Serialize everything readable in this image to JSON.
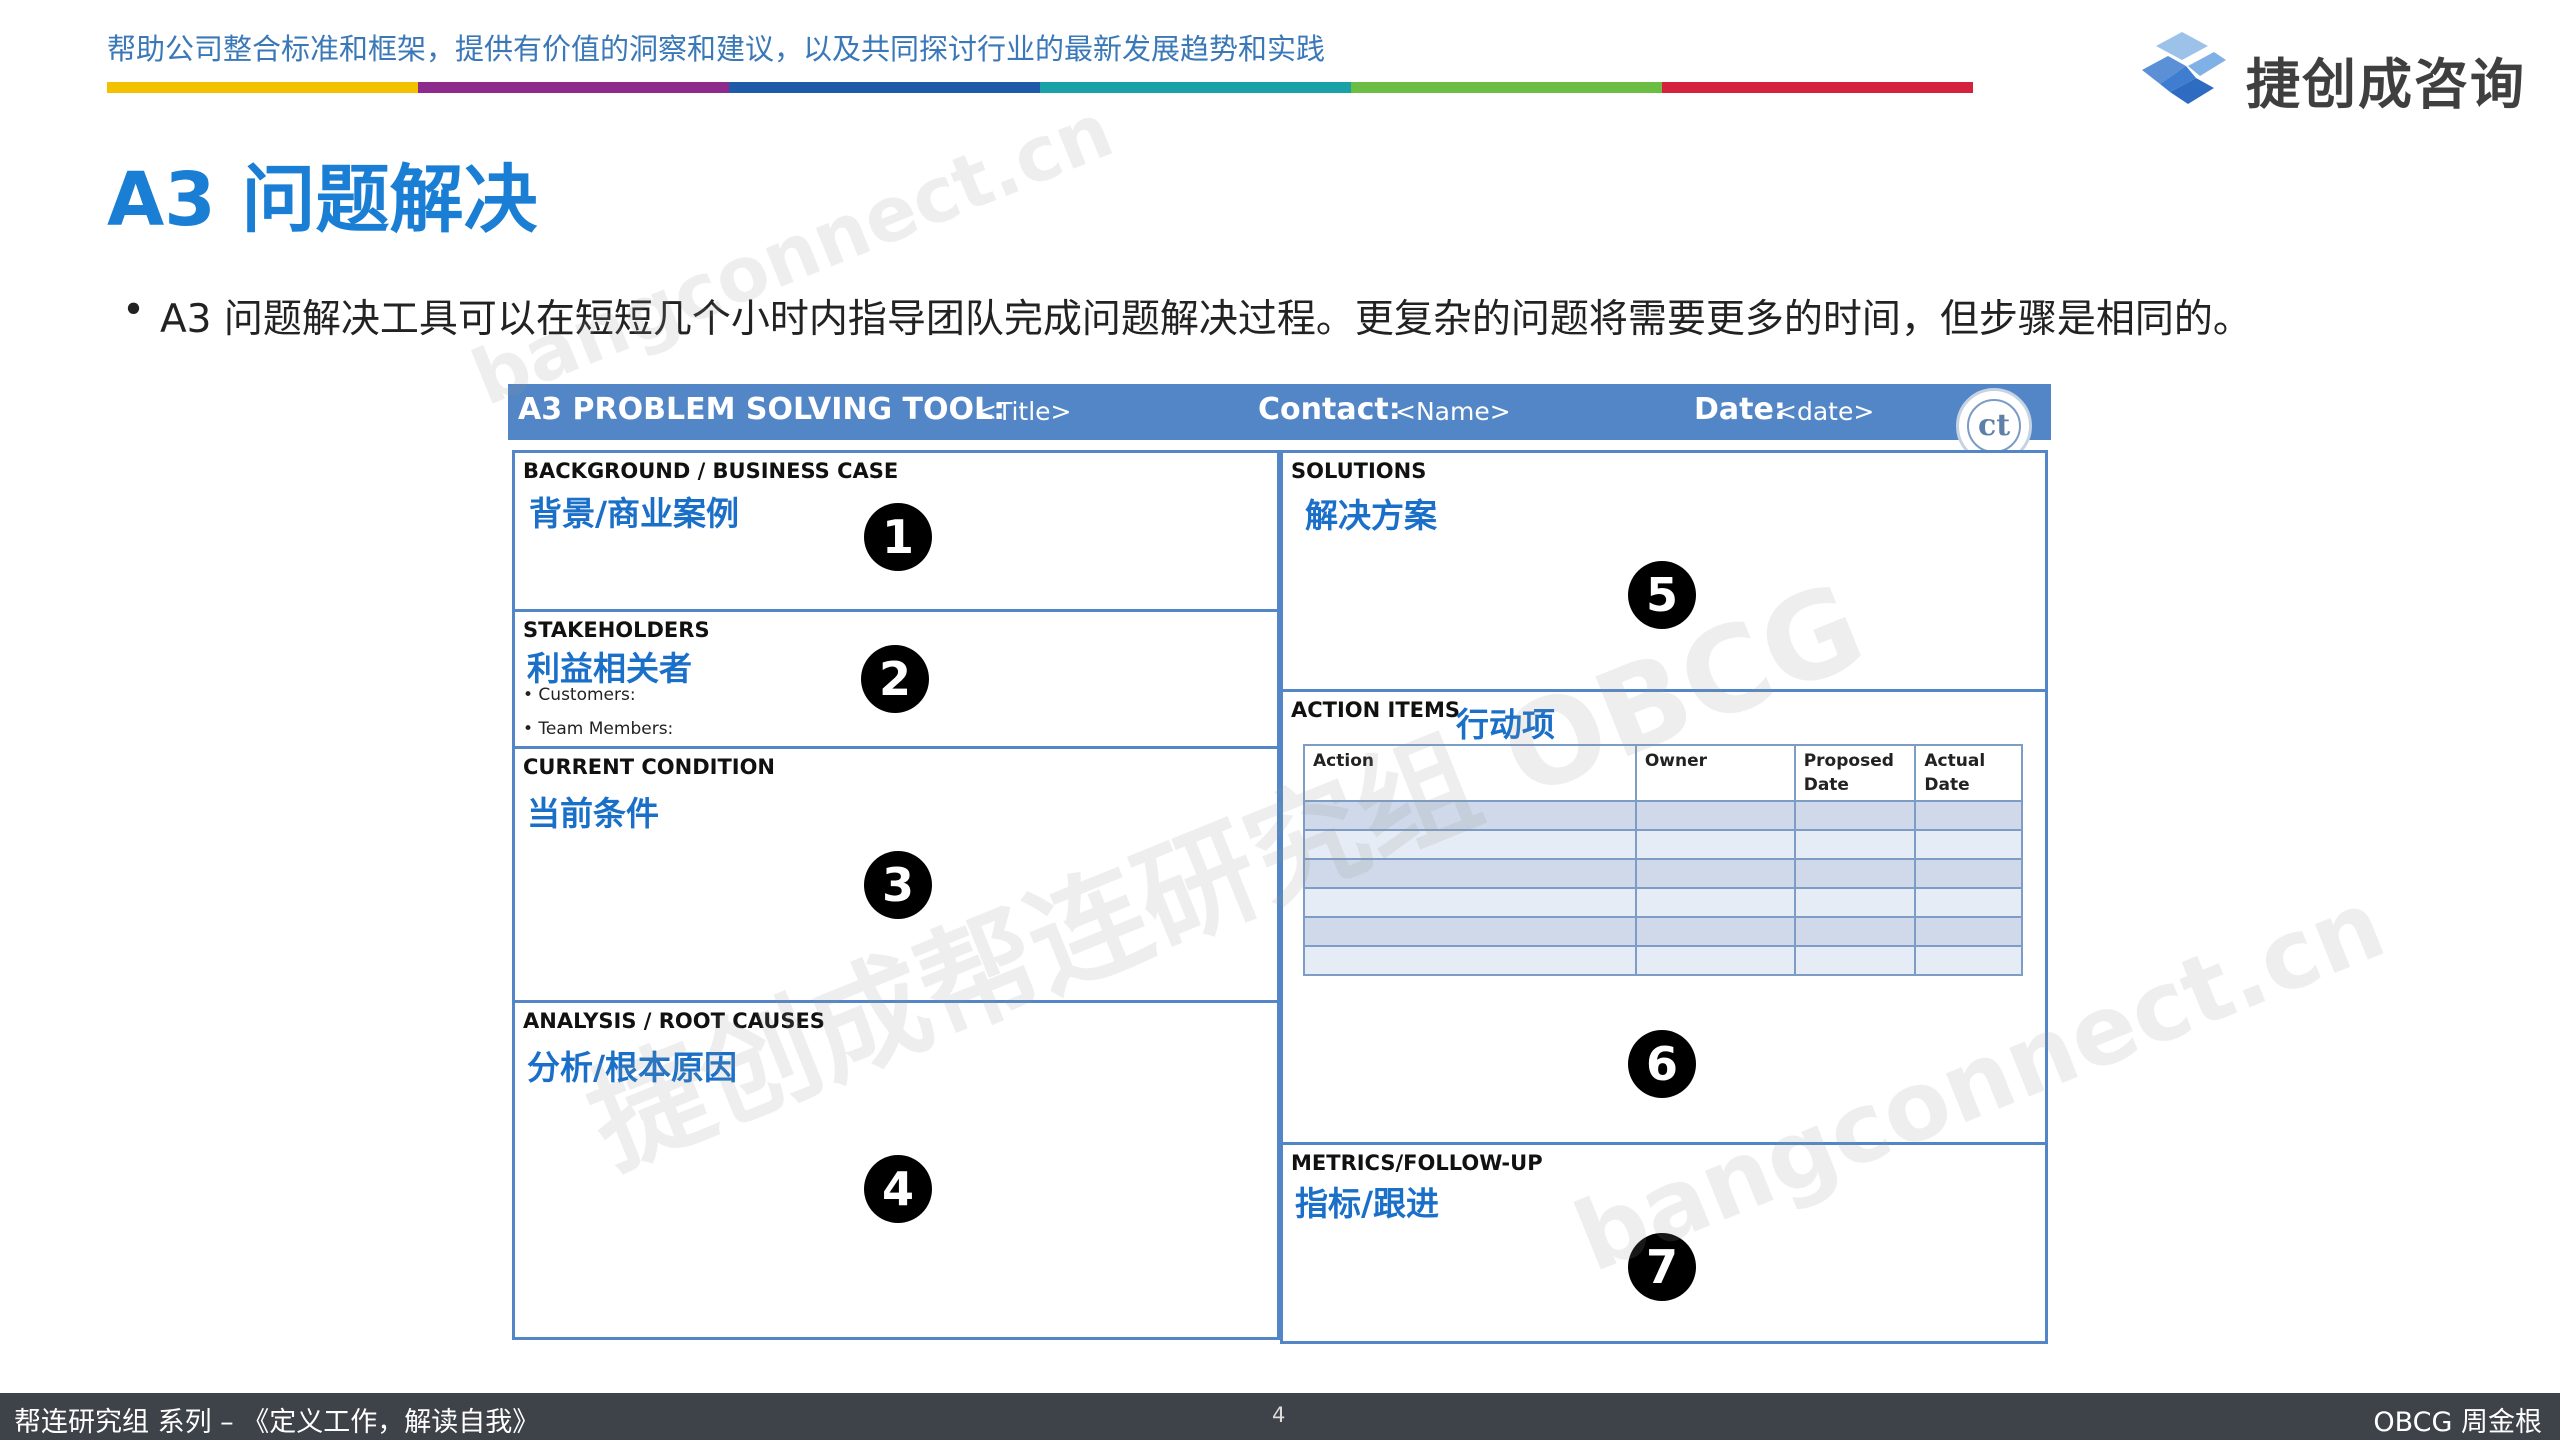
{
  "header": {
    "tagline": "帮助公司整合标准和框架，提供有价值的洞察和建议，以及共同探讨行业的最新发展趋势和实践",
    "color_bar": [
      "#f2c200",
      "#8e2a8c",
      "#1f5aa8",
      "#18a2a8",
      "#6bbd44",
      "#d4213d"
    ],
    "logo_text": "捷创成咨询",
    "logo_icon": "cube-logo-icon"
  },
  "title": "A3 问题解决",
  "bullet": {
    "dot": "•",
    "text": "A3 问题解决工具可以在短短几个小时内指导团队完成问题解决过程。更复杂的问题将需要更多的时间，但步骤是相同的。"
  },
  "watermarks": [
    "bangconnect.cn",
    "捷创成帮连研究组 OBCG",
    "bangconnect.cn"
  ],
  "a3": {
    "header": {
      "tool_label": "A3 PROBLEM SOLVING TOOL:",
      "title_value": "<Title>",
      "contact_label": "Contact:",
      "contact_value": "<Name>",
      "date_label": "Date:",
      "date_value": "<date>",
      "seal_text": "ct"
    },
    "sections": {
      "background": {
        "label": "BACKGROUND / BUSINESS CASE",
        "cn": "背景/商业案例",
        "num": "1"
      },
      "stakeholders": {
        "label": "STAKEHOLDERS",
        "cn": "利益相关者",
        "num": "2",
        "items": [
          "• Customers:",
          "• Team Members:"
        ]
      },
      "current": {
        "label": "CURRENT CONDITION",
        "cn": "当前条件",
        "num": "3"
      },
      "analysis": {
        "label": "ANALYSIS / ROOT CAUSES",
        "cn": "分析/根本原因",
        "num": "4"
      },
      "solutions": {
        "label": "SOLUTIONS",
        "cn": "解决方案",
        "num": "5"
      },
      "action_items": {
        "label": "ACTION ITEMS",
        "cn": "行动项",
        "num": "6",
        "columns": [
          "Action",
          "Owner",
          "Proposed Date",
          "Actual Date"
        ]
      },
      "metrics": {
        "label": "METRICS/FOLLOW-UP",
        "cn": "指标/跟进",
        "num": "7"
      }
    }
  },
  "footer": {
    "left": "帮连研究组 系列 – 《定义工作，解读自我》",
    "page": "4",
    "right": "OBCG 周金根"
  }
}
